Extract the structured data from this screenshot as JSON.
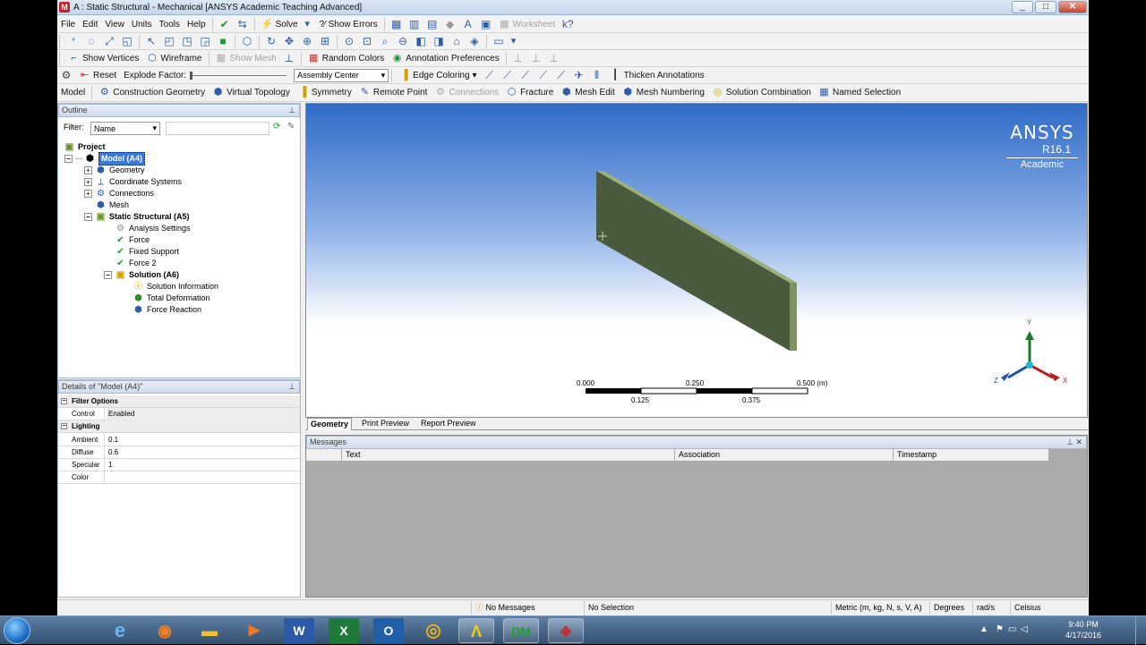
{
  "window": {
    "title": "A : Static Structural - Mechanical [ANSYS Academic Teaching Advanced]",
    "app_icon": "M",
    "controls": [
      "_",
      "□",
      "✕"
    ]
  },
  "menu": {
    "items": [
      "File",
      "Edit",
      "View",
      "Units",
      "Tools",
      "Help"
    ],
    "solve_label": "Solve",
    "show_errors_label": "?⁄ Show Errors",
    "worksheet_label": "Worksheet"
  },
  "toolbar3": {
    "show_vertices": "Show Vertices",
    "wireframe": "Wireframe",
    "show_mesh": "Show Mesh",
    "random_colors": "Random Colors",
    "annotation_preferences": "Annotation Preferences"
  },
  "toolbar4": {
    "reset": "Reset",
    "explode_factor": "Explode Factor:",
    "assembly_center": "Assembly Center",
    "edge_coloring": "Edge Coloring",
    "thicken_annotations": "Thicken Annotations"
  },
  "context_toolbar": {
    "model": "Model",
    "construction_geometry": "Construction Geometry",
    "virtual_topology": "Virtual Topology",
    "symmetry": "Symmetry",
    "remote_point": "Remote Point",
    "connections": "Connections",
    "fracture": "Fracture",
    "mesh_edit": "Mesh Edit",
    "mesh_numbering": "Mesh Numbering",
    "solution_combination": "Solution Combination",
    "named_selection": "Named Selection"
  },
  "outline": {
    "header": "Outline",
    "filter_label": "Filter:",
    "filter_value": "Name",
    "tree": {
      "project": "Project",
      "model": "Model (A4)",
      "geometry": "Geometry",
      "coordinate_systems": "Coordinate Systems",
      "connections": "Connections",
      "mesh": "Mesh",
      "static_structural": "Static Structural (A5)",
      "analysis_settings": "Analysis Settings",
      "force": "Force",
      "fixed_support": "Fixed Support",
      "force2": "Force 2",
      "solution": "Solution (A6)",
      "solution_information": "Solution Information",
      "total_deformation": "Total Deformation",
      "force_reaction": "Force Reaction"
    }
  },
  "details": {
    "header": "Details of \"Model (A4)\"",
    "filter_options": "Filter Options",
    "control_label": "Control",
    "control_value": "Enabled",
    "lighting": "Lighting",
    "ambient_label": "Ambient",
    "ambient_value": "0.1",
    "diffuse_label": "Diffuse",
    "diffuse_value": "0.6",
    "specular_label": "Specular",
    "specular_value": "1",
    "color_label": "Color"
  },
  "viewport": {
    "logo_main": "ANSYS",
    "logo_release": "R16.1",
    "logo_edition": "Academic",
    "scale_top": [
      "0.000",
      "0.250",
      "0.500 (m)"
    ],
    "scale_bottom": [
      "0.125",
      "0.375"
    ],
    "axis_x": "X",
    "axis_y": "Y",
    "axis_z": "Z"
  },
  "tabs": [
    "Geometry",
    "Print Preview",
    "Report Preview"
  ],
  "messages": {
    "header": "Messages",
    "columns": [
      "Text",
      "Association",
      "Timestamp"
    ]
  },
  "status": {
    "no_messages": "No Messages",
    "no_selection": "No Selection",
    "units": "Metric (m, kg, N, s, V, A)",
    "degrees": "Degrees",
    "rads": "rad/s",
    "celsius": "Celsius"
  },
  "taskbar": {
    "time": "9:40 PM",
    "date": "4/17/2016",
    "apps": [
      "ie-icon",
      "firefox-icon",
      "explorer-icon",
      "media-player-icon",
      "word-icon",
      "excel-icon",
      "outlook-icon",
      "chrome-icon",
      "ansys-workbench-icon",
      "designmodeler-icon",
      "mechanical-icon"
    ]
  },
  "colors": {
    "selection": "#3b79d4",
    "viewport_top": "#2f6bc7",
    "beam_face": "#4a5a3c"
  }
}
